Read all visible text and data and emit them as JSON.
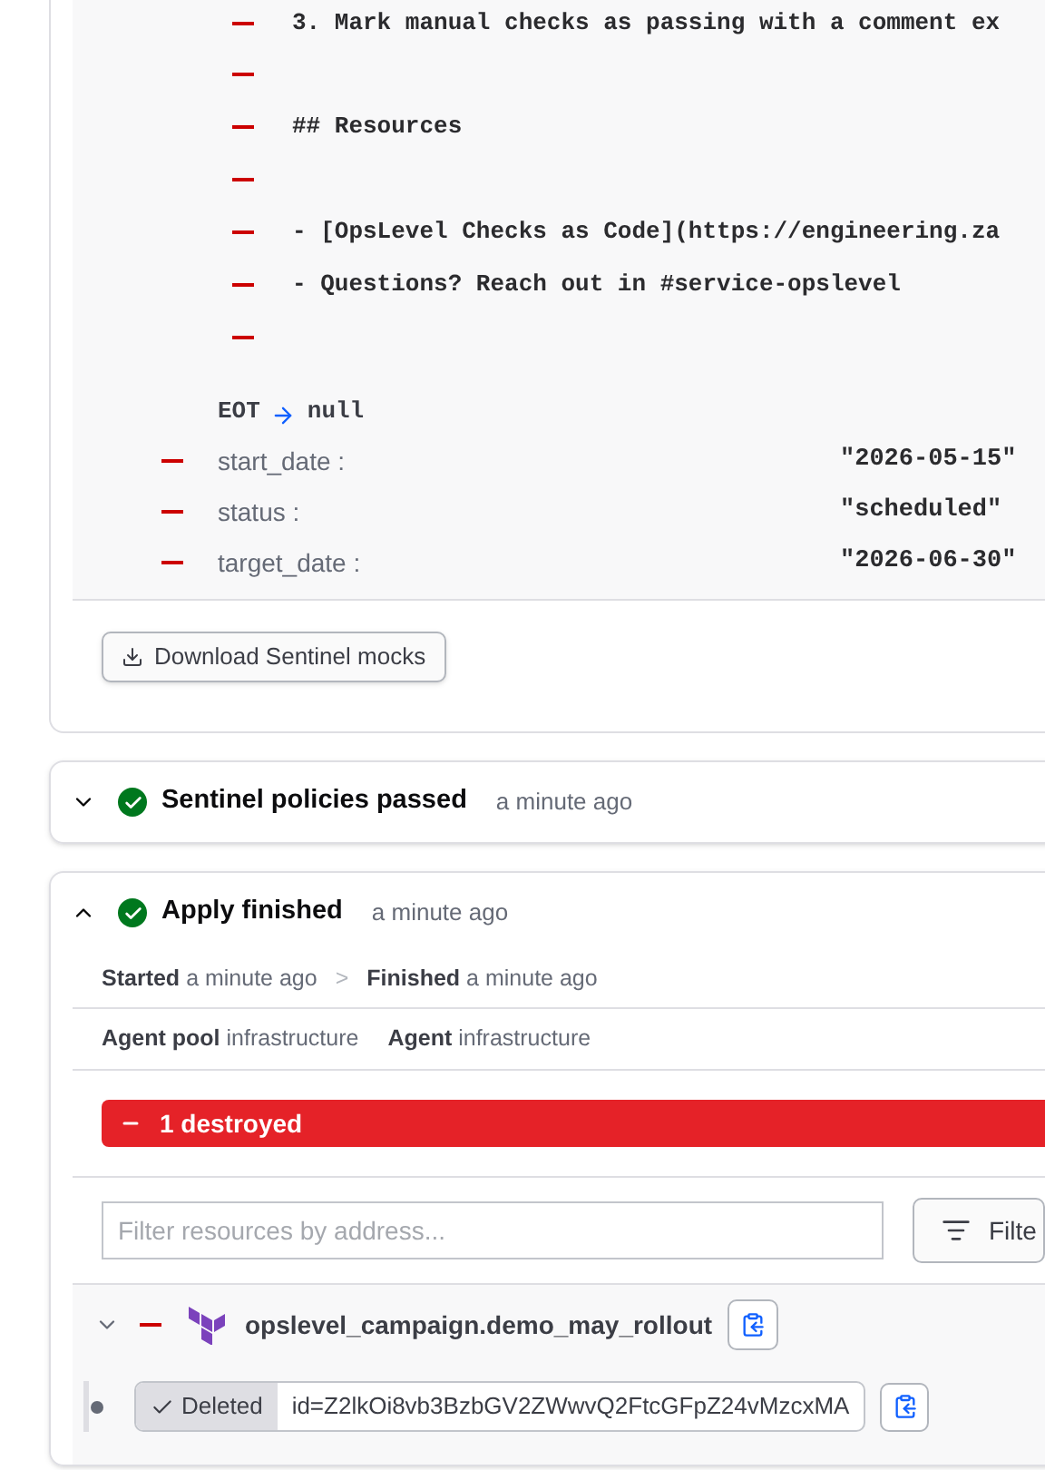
{
  "diff": {
    "lines": [
      {
        "kind": "removed",
        "text": "3. Mark manual checks as passing with a comment ex"
      },
      {
        "kind": "removed"
      },
      {
        "kind": "removed",
        "text": "## Resources"
      },
      {
        "kind": "removed"
      },
      {
        "kind": "removed",
        "text": "- [OpsLevel Checks as Code](https://engineering.za"
      },
      {
        "kind": "removed",
        "text": "- Questions? Reach out in #service-opslevel"
      },
      {
        "kind": "removed"
      }
    ],
    "eot": {
      "label": "EOT",
      "value": "null"
    },
    "attributes": [
      {
        "kind": "removed",
        "key": "start_date :",
        "value": "\"2026-05-15\""
      },
      {
        "kind": "removed",
        "key": "status :",
        "value": "\"scheduled\""
      },
      {
        "kind": "removed",
        "key": "target_date :",
        "value": "\"2026-06-30\""
      }
    ]
  },
  "download_button": "Download Sentinel mocks",
  "stages": [
    {
      "title": "Sentinel policies passed",
      "time": "a minute ago",
      "kind": "passed",
      "expanded": false
    },
    {
      "title": "Apply finished",
      "time": "a minute ago",
      "kind": "passed",
      "expanded": true
    }
  ],
  "apply": {
    "started_label": "Started",
    "started": "a minute ago",
    "separator": ">",
    "finished_label": "Finished",
    "finished": "a minute ago",
    "agent_pool_label": "Agent pool",
    "agent_pool": "infrastructure",
    "agent_label": "Agent",
    "agent": "infrastructure",
    "summary": "1 destroyed",
    "filter": {
      "placeholder": "Filter resources by address...",
      "button": "Filte"
    },
    "resource": {
      "expanded": true,
      "kind": "removed",
      "address": "opslevel_campaign.demo_may_rollout",
      "state": "Deleted",
      "id": "id=Z2lkOi8vb3BzbGV2ZWwvQ2FtcGFpZ24vMzcxMA"
    }
  }
}
